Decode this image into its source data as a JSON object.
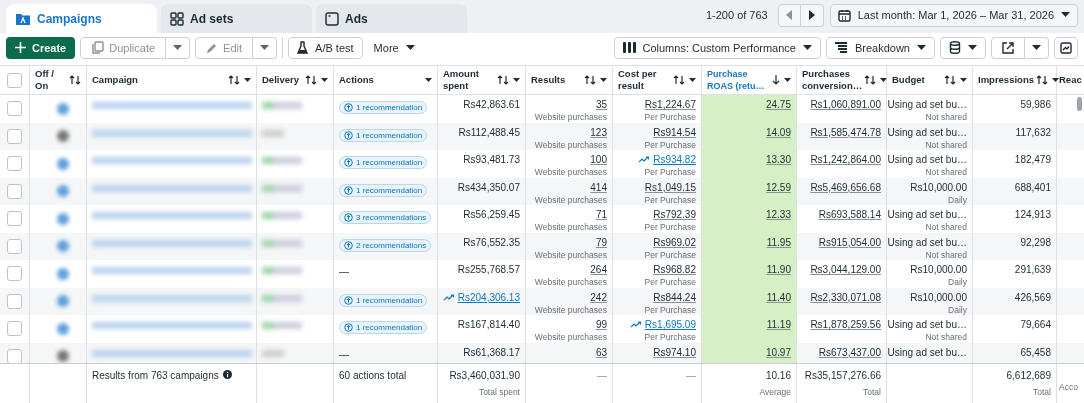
{
  "tabs": [
    {
      "label": "Campaigns",
      "selected": true
    },
    {
      "label": "Ad sets",
      "selected": false
    },
    {
      "label": "Ads",
      "selected": false
    }
  ],
  "select_all": {
    "checked": false
  },
  "pagination": {
    "range": "1-200 of 763"
  },
  "date_range": {
    "label": "Last month: Mar 1, 2026 – Mar 31, 2026"
  },
  "toolbar": {
    "create": "Create",
    "duplicate": {
      "label": "Duplicate",
      "disabled": true
    },
    "edit": {
      "label": "Edit",
      "disabled": true
    },
    "ab_test": "A/B test",
    "more": "More",
    "columns": "Columns: Custom Performance",
    "breakdown": "Breakdown"
  },
  "columns": [
    {
      "label": "Off / On",
      "sortable": true,
      "descending": false,
      "menu": false
    },
    {
      "label": "Campaign",
      "sortable": true,
      "descending": false,
      "menu": true
    },
    {
      "label": "Delivery",
      "sortable": true,
      "descending": false,
      "menu": true
    },
    {
      "label": "Actions",
      "sortable": false,
      "descending": false,
      "menu": true
    },
    {
      "label": "Amount spent",
      "sortable": true,
      "descending": false,
      "menu": true
    },
    {
      "label": "Results",
      "sortable": true,
      "descending": false,
      "menu": true
    },
    {
      "label": "Cost per result",
      "sortable": true,
      "descending": false,
      "menu": true
    },
    {
      "label": "Purchase ROAS (retu…",
      "sortable": true,
      "descending": true,
      "menu": true
    },
    {
      "label": "Purchases conversion…",
      "sortable": true,
      "descending": false,
      "menu": true
    },
    {
      "label": "Budget",
      "sortable": true,
      "descending": false,
      "menu": true
    },
    {
      "label": "Impressions",
      "sortable": true,
      "descending": false,
      "menu": true
    },
    {
      "label": "Reac",
      "sortable": false,
      "descending": false,
      "menu": false
    }
  ],
  "rows": [
    {
      "selected": false,
      "on": true,
      "actions": "1 recommendation",
      "amount": {
        "text": "Rs42,863.61",
        "trend": false
      },
      "results": "35",
      "results_sub": "Website purchases",
      "cost": {
        "text": "Rs1,224.67",
        "trend": false
      },
      "cost_sub": "Per Purchase",
      "roas": "24.75",
      "purchases_value": "Rs1,060,891.00",
      "budget": "Using ad set bu…",
      "budget_sub": "Not shared",
      "impressions": "59,986"
    },
    {
      "selected": false,
      "on": false,
      "actions": "1 recommendation",
      "amount": {
        "text": "Rs112,488.45",
        "trend": false
      },
      "results": "123",
      "results_sub": "Website purchases",
      "cost": {
        "text": "Rs914.54",
        "trend": false
      },
      "cost_sub": "Per Purchase",
      "roas": "14.09",
      "purchases_value": "Rs1,585,474.78",
      "budget": "Using ad set bu…",
      "budget_sub": "Not shared",
      "impressions": "117,632"
    },
    {
      "selected": false,
      "on": true,
      "actions": "1 recommendation",
      "amount": {
        "text": "Rs93,481.73",
        "trend": false
      },
      "results": "100",
      "results_sub": "Website purchases",
      "cost": {
        "text": "Rs934.82",
        "trend": true
      },
      "cost_sub": "Per Purchase",
      "roas": "13.30",
      "purchases_value": "Rs1,242,864.00",
      "budget": "Using ad set bu…",
      "budget_sub": "Not shared",
      "impressions": "182,479"
    },
    {
      "selected": false,
      "on": true,
      "actions": "1 recommendation",
      "amount": {
        "text": "Rs434,350.07",
        "trend": false
      },
      "results": "414",
      "results_sub": "Website purchases",
      "cost": {
        "text": "Rs1,049.15",
        "trend": false
      },
      "cost_sub": "Per Purchase",
      "roas": "12.59",
      "purchases_value": "Rs5,469,656.68",
      "budget": "Rs10,000.00",
      "budget_sub": "Daily",
      "impressions": "688,401"
    },
    {
      "selected": false,
      "on": true,
      "actions": "3 recommendations",
      "amount": {
        "text": "Rs56,259.45",
        "trend": false
      },
      "results": "71",
      "results_sub": "Website purchases",
      "cost": {
        "text": "Rs792.39",
        "trend": false
      },
      "cost_sub": "Per Purchase",
      "roas": "12.33",
      "purchases_value": "Rs693,588.14",
      "budget": "Using ad set bu…",
      "budget_sub": "Not shared",
      "impressions": "124,913"
    },
    {
      "selected": false,
      "on": true,
      "actions": "2 recommendations",
      "amount": {
        "text": "Rs76,552.35",
        "trend": false
      },
      "results": "79",
      "results_sub": "Website purchases",
      "cost": {
        "text": "Rs969.02",
        "trend": false
      },
      "cost_sub": "Per Purchase",
      "roas": "11.95",
      "purchases_value": "Rs915,054.00",
      "budget": "Using ad set bu…",
      "budget_sub": "Not shared",
      "impressions": "92,298"
    },
    {
      "selected": false,
      "on": true,
      "actions": "—",
      "amount": {
        "text": "Rs255,768.57",
        "trend": false
      },
      "results": "264",
      "results_sub": "Website purchases",
      "cost": {
        "text": "Rs968.82",
        "trend": false
      },
      "cost_sub": "Per Purchase",
      "roas": "11.90",
      "purchases_value": "Rs3,044,129.00",
      "budget": "Rs10,000.00",
      "budget_sub": "Daily",
      "impressions": "291,639"
    },
    {
      "selected": false,
      "on": true,
      "actions": "1 recommendation",
      "amount": {
        "text": "Rs204,306.13",
        "trend": true
      },
      "results": "242",
      "results_sub": "Website purchases",
      "cost": {
        "text": "Rs844.24",
        "trend": false
      },
      "cost_sub": "Per Purchase",
      "roas": "11.40",
      "purchases_value": "Rs2,330,071.08",
      "budget": "Rs10,000.00",
      "budget_sub": "Daily",
      "impressions": "426,569"
    },
    {
      "selected": false,
      "on": true,
      "actions": "1 recommendation",
      "amount": {
        "text": "Rs167,814.40",
        "trend": false
      },
      "results": "99",
      "results_sub": "Website purchases",
      "cost": {
        "text": "Rs1,695.09",
        "trend": true
      },
      "cost_sub": "Per Purchase",
      "roas": "11.19",
      "purchases_value": "Rs1,878,259.56",
      "budget": "Using ad set bu…",
      "budget_sub": "Not shared",
      "impressions": "79,664"
    },
    {
      "selected": false,
      "on": false,
      "actions": "—",
      "amount": {
        "text": "Rs61,368.17",
        "trend": false
      },
      "results": "63",
      "cost": {
        "text": "Rs974.10",
        "trend": false
      },
      "roas": "10.97",
      "purchases_value": "Rs673,437.00",
      "budget": "Using ad set bu…",
      "impressions": "65,458"
    }
  ],
  "footer": {
    "campaign": "Results from 763 campaigns",
    "actions": "60 actions total",
    "amount": "Rs3,460,031.90",
    "amount_sub": "Total spent",
    "results": "—",
    "cost": "—",
    "roas": "10.16",
    "roas_sub": "Average",
    "purchases_value": "Rs35,157,276.66",
    "purchases_sub": "Total",
    "impressions": "6,612,689",
    "impressions_sub": "Total",
    "reach_sub": "Acco"
  }
}
